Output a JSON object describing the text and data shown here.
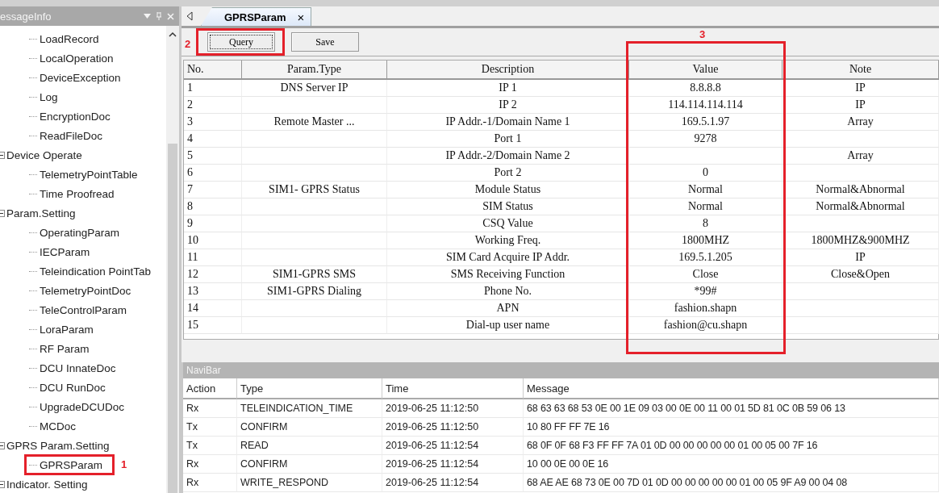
{
  "sidebar": {
    "title": "essageInfo",
    "tree": [
      {
        "children": [
          {
            "label": "LoadRecord"
          },
          {
            "label": "LocalOperation"
          },
          {
            "label": "DeviceException"
          },
          {
            "label": "Log"
          },
          {
            "label": "EncryptionDoc"
          },
          {
            "label": "ReadFileDoc"
          }
        ]
      },
      {
        "label": "Device Operate",
        "children": [
          {
            "label": "TelemetryPointTable"
          },
          {
            "label": "Time Proofread"
          }
        ]
      },
      {
        "label": "Param.Setting",
        "children": [
          {
            "label": "OperatingParam"
          },
          {
            "label": "IECParam"
          },
          {
            "label": "Teleindication PointTab"
          },
          {
            "label": "TelemetryPointDoc"
          },
          {
            "label": "TeleControlParam"
          },
          {
            "label": "LoraParam"
          },
          {
            "label": "RF Param"
          },
          {
            "label": "DCU InnateDoc"
          },
          {
            "label": "DCU RunDoc"
          },
          {
            "label": "UpgradeDCUDoc"
          },
          {
            "label": "MCDoc"
          }
        ]
      },
      {
        "label": "GPRS Param.Setting",
        "children": [
          {
            "label": "GPRSParam",
            "annotation": "1"
          }
        ]
      },
      {
        "label": "Indicator. Setting"
      }
    ]
  },
  "tabs": [
    {
      "label": "GPRSParam",
      "selected": true,
      "close": "×"
    }
  ],
  "toolbar": [
    {
      "label": "Query",
      "focused": true,
      "annotation": "2"
    },
    {
      "label": "Save",
      "focused": false
    }
  ],
  "param_table": {
    "columns": [
      {
        "label": "No."
      },
      {
        "label": "Param.Type"
      },
      {
        "label": "Description"
      },
      {
        "label": "Value",
        "annotation": "3"
      },
      {
        "label": "Note"
      }
    ],
    "rows": [
      [
        "1",
        "DNS Server IP",
        "IP 1",
        "8.8.8.8",
        "IP"
      ],
      [
        "2",
        "",
        "IP 2",
        "114.114.114.114",
        "IP"
      ],
      [
        "3",
        "Remote Master ...",
        "IP Addr.-1/Domain Name 1",
        "169.5.1.97",
        "Array"
      ],
      [
        "4",
        "",
        "Port 1",
        "9278",
        ""
      ],
      [
        "5",
        "",
        "IP Addr.-2/Domain Name 2",
        "",
        "Array"
      ],
      [
        "6",
        "",
        "Port 2",
        "0",
        ""
      ],
      [
        "7",
        "SIM1- GPRS Status",
        "Module Status",
        "Normal",
        "Normal&Abnormal"
      ],
      [
        "8",
        "",
        "SIM Status",
        "Normal",
        "Normal&Abnormal"
      ],
      [
        "9",
        "",
        "CSQ Value",
        "8",
        ""
      ],
      [
        "10",
        "",
        "Working Freq.",
        "1800MHZ",
        "1800MHZ&900MHZ"
      ],
      [
        "11",
        "",
        "SIM Card Acquire IP Addr.",
        "169.5.1.205",
        "IP"
      ],
      [
        "12",
        "SIM1-GPRS SMS",
        "SMS Receiving Function",
        "Close",
        "Close&Open"
      ],
      [
        "13",
        "SIM1-GPRS Dialing",
        "Phone No.",
        "*99#",
        ""
      ],
      [
        "14",
        "",
        "APN",
        "fashion.shapn",
        ""
      ],
      [
        "15",
        "",
        "Dial-up user name",
        "fashion@cu.shapn",
        ""
      ]
    ]
  },
  "navibar": {
    "title": "NaviBar",
    "columns": [
      "Action",
      "Type",
      "Time",
      "Message"
    ],
    "rows": [
      [
        "Rx",
        "TELEINDICATION_TIME",
        "2019-06-25 11:12:50",
        "68 63 63 68 53 0E 00 1E 09 03 00 0E 00 11 00 01 5D 81 0C 0B 59 06 13"
      ],
      [
        "Tx",
        "CONFIRM",
        "2019-06-25 11:12:50",
        "10 80 FF FF 7E 16"
      ],
      [
        "Tx",
        "READ",
        "2019-06-25 11:12:54",
        "68 0F 0F 68 F3 FF FF 7A 01 0D 00 00 00 00 00 01 00 05 00 7F 16"
      ],
      [
        "Rx",
        "CONFIRM",
        "2019-06-25 11:12:54",
        "10 00 0E 00 0E 16"
      ],
      [
        "Rx",
        "WRITE_RESPOND",
        "2019-06-25 11:12:54",
        "68 AE AE 68 73 0E 00 7D 01 0D 00 00 00 00 00 01 00 05 9F A9 00 04 08"
      ]
    ]
  }
}
